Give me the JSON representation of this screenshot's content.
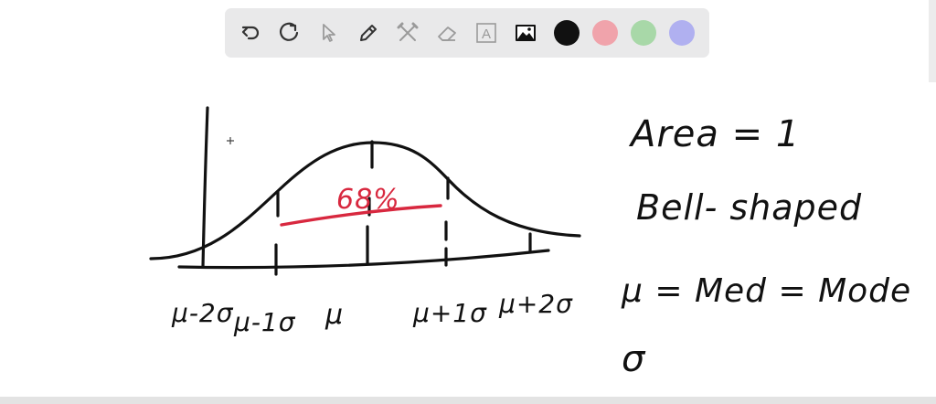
{
  "toolbar": {
    "tools": [
      {
        "name": "undo-icon"
      },
      {
        "name": "redo-icon"
      },
      {
        "name": "pointer-icon"
      },
      {
        "name": "pen-icon"
      },
      {
        "name": "tools-icon"
      },
      {
        "name": "eraser-icon"
      },
      {
        "name": "text-icon",
        "glyph": "A"
      },
      {
        "name": "image-icon"
      }
    ],
    "colors": [
      "#111111",
      "#f0a3ab",
      "#a8d8a8",
      "#b0b0f0"
    ]
  },
  "board": {
    "curve_labels": {
      "mu_minus_2s": "μ-2σ",
      "mu_minus_1s": "μ-1σ",
      "mu": "μ",
      "mu_plus_1s": "μ+1σ",
      "mu_plus_2s": "μ+2σ",
      "percent": "68%"
    },
    "notes": {
      "area": "Area = 1",
      "shape": "Bell- shaped",
      "equality": "μ = Med = Mode",
      "sigma": "σ"
    }
  }
}
